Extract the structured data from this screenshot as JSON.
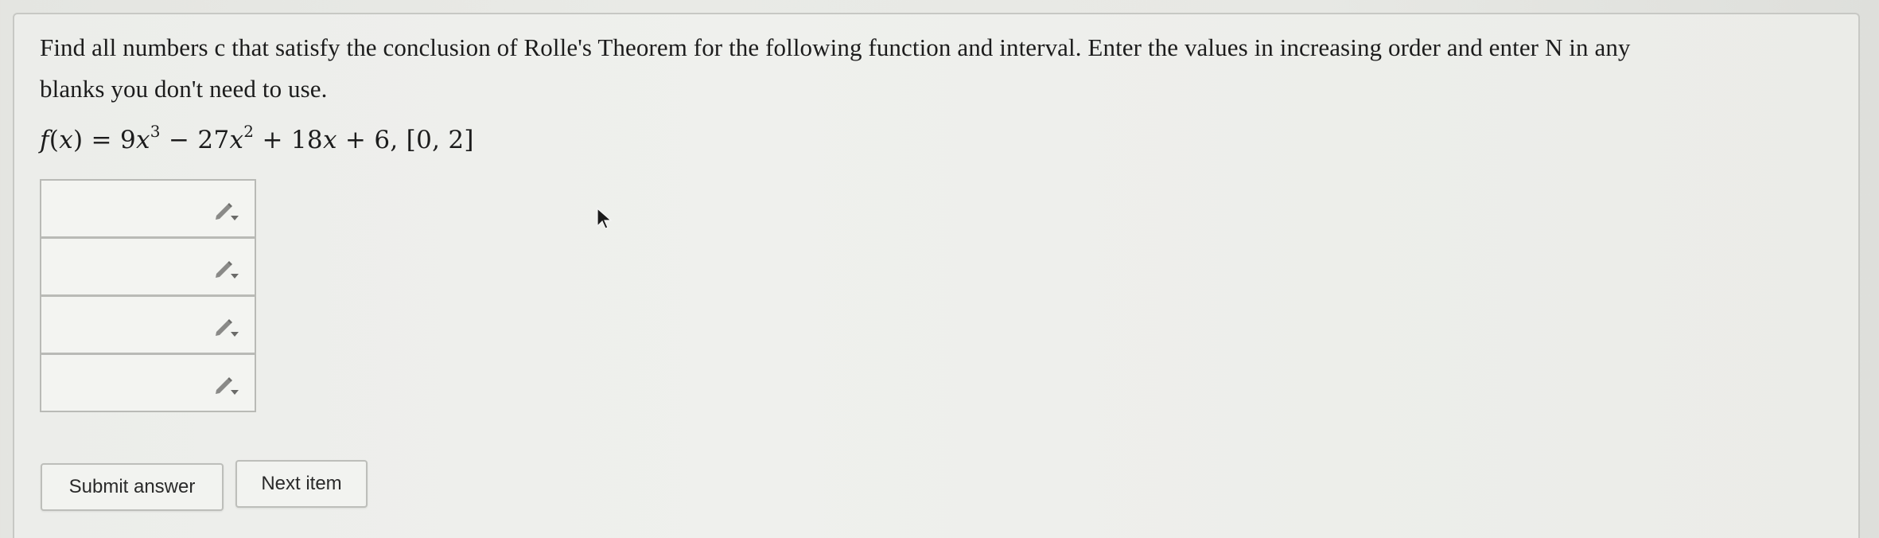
{
  "question": {
    "line1": "Find all numbers c that satisfy the conclusion of Rolle's Theorem for the following function and interval. Enter the values in increasing order and enter N in any",
    "line2": "blanks you don't need to use."
  },
  "formula": {
    "fname": "f",
    "var": "x",
    "coef1": "9",
    "exp1": "3",
    "coef2": "27",
    "exp2": "2",
    "coef3": "18",
    "constant": "6",
    "interval": "[0, 2]"
  },
  "answers": [
    {
      "value": ""
    },
    {
      "value": ""
    },
    {
      "value": ""
    },
    {
      "value": ""
    }
  ],
  "icons": {
    "answer_tool": "pencil-dropdown-icon",
    "pointer": "mouse-cursor-icon"
  },
  "buttons": {
    "submit_label": "Submit answer",
    "next_label": "Next item"
  }
}
